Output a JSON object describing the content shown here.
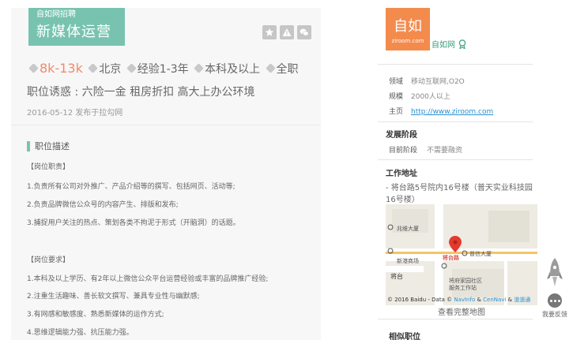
{
  "job": {
    "company_small": "自如网招聘",
    "title": "新媒体运营",
    "salary": "8k-13k",
    "city": "北京",
    "experience": "经验1-3年",
    "education": "本科及以上",
    "type": "全职",
    "allure": "职位诱惑 : 六险一金 租房折扣 高大上办公环境",
    "publish_time": "2016-05-12  发布于拉勾网"
  },
  "actions": {
    "favorite_icon": "star-icon",
    "report_icon": "warning-icon",
    "share_icon": "wechat-icon"
  },
  "description": {
    "title": "职位描述",
    "lines": [
      "【岗位职责】",
      "1.负责所有公司对外推广、产品介绍等的撰写、包括网页、活动等;",
      "2.负责品牌微信公众号的内容产生、排版和发布;",
      "3.捕捉用户关注的热点、策划各类不拘泥于形式（开脑洞）的话题。",
      "【岗位要求】",
      "1.本科及以上学历、有2年以上微信公众平台运营经验或丰富的品牌推广经验;",
      "2.注重生活趣味、善长软文撰写、兼具专业性与幽默感;",
      "3.有网感和敏感度、熟悉新媒体的运作方式;",
      "4.思维逻辑能力强、抗压能力强。"
    ]
  },
  "company": {
    "logo_text": "自如",
    "logo_domain": "ziroom.com",
    "name": "自如网",
    "field_label": "领域",
    "field_value": "移动互联网,O2O",
    "scale_label": "规模",
    "scale_value": "2000人以上",
    "home_label": "主页",
    "home_value": "http://www.ziroom.com",
    "stage_title": "发展阶段",
    "stage_label": "目前阶段",
    "stage_value": "不需要融资",
    "address_title": "工作地址",
    "address": "- 将台路5号院内16号楼（普天实业科技园16号楼）"
  },
  "map": {
    "labels": {
      "north": "兆维大厦",
      "west": "新港商场",
      "road": "将台路",
      "east": "普信大厦",
      "village": "将台",
      "community": "将府家园社区",
      "office": "服务工作站"
    },
    "copyright_pre": "© 2016 Baidu - Data © ",
    "copyright_n1": "NavInfo",
    "copyright_mid": " & ",
    "copyright_n2": "CenNavi",
    "copyright_sep": " & ",
    "copyright_n3": "道道通",
    "view_full": "查看完整地图"
  },
  "similar_title": "相似职位",
  "feedback": "我要反馈",
  "colors": {
    "accent": "#78c3b0",
    "salary": "#f08b6c",
    "logo": "#f38b4d",
    "link": "#2b8fcf"
  }
}
